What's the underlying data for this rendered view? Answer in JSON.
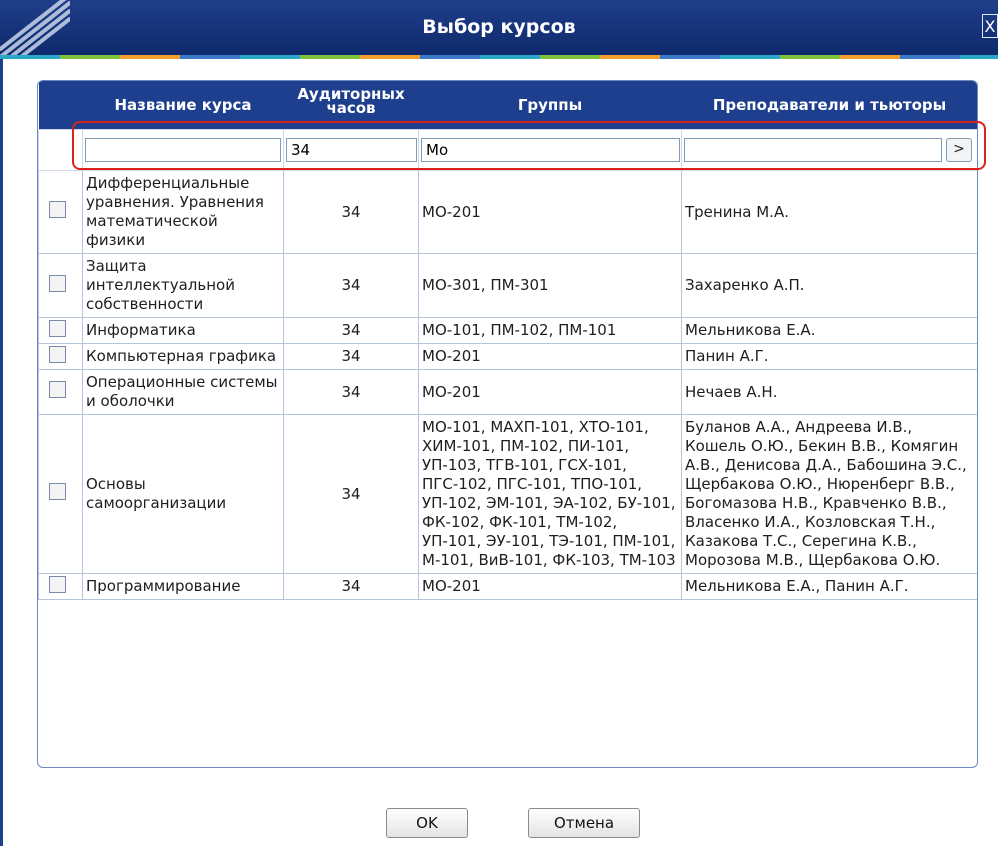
{
  "window": {
    "title": "Выбор курсов",
    "close_label": "X"
  },
  "table": {
    "columns": [
      "Название курса",
      "Аудиторных часов",
      "Группы",
      "Преподаватели и тьюторы"
    ],
    "filter": {
      "name": "",
      "hours": "34",
      "groups": "Мо",
      "teachers": "",
      "apply_label": ">"
    },
    "rows": [
      {
        "name": "Дифференциальные уравнения. Уравнения математической физики",
        "hours": "34",
        "groups": "МО-201",
        "teachers": "Тренина М.А."
      },
      {
        "name": "Защита интеллектуальной собственности",
        "hours": "34",
        "groups": "МО-301, ПМ-301",
        "teachers": "Захаренко А.П."
      },
      {
        "name": "Информатика",
        "hours": "34",
        "groups": "МО-101, ПМ-102, ПМ-101",
        "teachers": "Мельникова Е.А."
      },
      {
        "name": "Компьютерная графика",
        "hours": "34",
        "groups": "МО-201",
        "teachers": "Панин А.Г."
      },
      {
        "name": "Операционные системы и оболочки",
        "hours": "34",
        "groups": "МО-201",
        "teachers": "Нечаев А.Н."
      },
      {
        "name": "Основы самоорганизации",
        "hours": "34",
        "groups": "МО-101, МАХП-101, ХТО-101, ХИМ-101, ПМ-102, ПИ-101, УП-103, ТГВ-101, ГСХ-101, ПГС-102, ПГС-101, ТПО-101, УП-102, ЭМ-101, ЭА-102, БУ-101, ФК-102, ФК-101, ТМ-102, УП-101, ЭУ-101, ТЭ-101, ПМ-101, М-101, ВиВ-101, ФК-103, ТМ-103",
        "teachers": "Буланов А.А., Андреева И.В., Кошель О.Ю., Бекин В.В., Комягин А.В., Денисова Д.А., Бабошина Э.С., Щербакова О.Ю., Нюренберг В.В., Богомазова Н.В., Кравченко В.В., Власенко И.А., Козловская Т.Н., Казакова Т.С., Серегина К.В., Морозова М.В., Щербакова О.Ю."
      },
      {
        "name": "Программирование",
        "hours": "34",
        "groups": "МО-201",
        "teachers": "Мельникова Е.А., Панин А.Г."
      }
    ]
  },
  "buttons": {
    "ok": "OK",
    "cancel": "Отмена"
  }
}
